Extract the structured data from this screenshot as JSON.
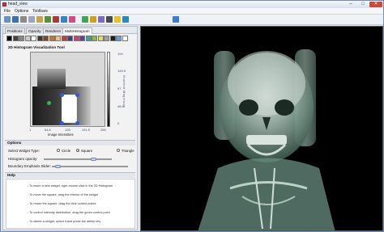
{
  "window": {
    "title": "head_view",
    "controls": [
      "–",
      "□",
      "✕"
    ]
  },
  "menu": [
    "File",
    "Options",
    "Toolbars"
  ],
  "toolbar": {
    "icons": [
      {
        "name": "open-icon",
        "color": "#6b8fc7"
      },
      {
        "name": "save-icon",
        "color": "#3d6fb4"
      },
      {
        "name": "cut-icon",
        "color": "#8a8a8a"
      },
      {
        "name": "copy-icon",
        "color": "#9aa7b8"
      },
      {
        "name": "paste-icon",
        "color": "#c9a24a"
      },
      {
        "name": "undo-icon",
        "color": "#5a8f3a"
      },
      {
        "name": "redo-icon",
        "color": "#a63a3a"
      },
      {
        "name": "zoom-icon",
        "color": "#2e86c8"
      },
      {
        "name": "color-icon",
        "color": "#d64a8a"
      },
      {
        "name": "transfer-icon",
        "color": "#3fa35a"
      },
      {
        "name": "volume-icon",
        "color": "#d4a017"
      },
      {
        "name": "settings-icon",
        "color": "#7c6ac4"
      },
      {
        "name": "camera-icon",
        "color": "#4a4a4a"
      },
      {
        "name": "light-icon",
        "color": "#e6c229"
      },
      {
        "name": "reset-icon",
        "color": "#2a8cb4"
      },
      {
        "name": "globe-icon",
        "color": "#3b7bd4"
      }
    ]
  },
  "tabs": [
    {
      "label": "Positions",
      "active": false
    },
    {
      "label": "Opacity",
      "active": false
    },
    {
      "label": "Renderer",
      "active": false
    },
    {
      "label": "MultiHistogram",
      "active": true
    }
  ],
  "swatches": [
    "#000000",
    "#444444",
    "#888888",
    "#cccccc",
    "#ffffff",
    "#3a3a3a",
    "#7a4a20",
    "#c07a30",
    "#f0c080",
    "#c04040",
    "#404080",
    "#d04060",
    "#6040a0",
    "#40a0a0",
    "#80c040",
    "#e0e060",
    "#a0a0a0",
    "#202020",
    "#60a0e0",
    "#ffffff"
  ],
  "histogram": {
    "title": "2D Histogram Visualization Tool",
    "y_ticks": [
      "194",
      "145.5",
      "97",
      "48.5",
      "0"
    ],
    "y_label": "Gradient Magnitude",
    "x_ticks": [
      "1",
      "64.5",
      "128",
      "191.5",
      "255"
    ],
    "x_label": "Image Intensities"
  },
  "options": {
    "header": "Options",
    "widget_type_label": "Select Widget Type:",
    "widget_types": [
      {
        "label": "Circle",
        "selected": false
      },
      {
        "label": "Square",
        "selected": true
      },
      {
        "label": "Triangle",
        "selected": false
      }
    ],
    "opacity_label": "Histogram opacity:",
    "opacity_value": 0.75,
    "emphasis_label": "Boundary Emphasis Slider:",
    "emphasis_value": 0.05
  },
  "help": {
    "header": "Help",
    "lines": [
      "- To insert a new widget, right-mouse click in the 2D Histogram",
      "- To move the square, drag the interior of the widget",
      "- To resize the square, drag the blue control points",
      "- To control intensity distribution, drag the green control point",
      "- To delete a widget, select it and press the delete key"
    ]
  },
  "viewport": {
    "background": "#000000",
    "render_tint": "#7fa89a"
  }
}
